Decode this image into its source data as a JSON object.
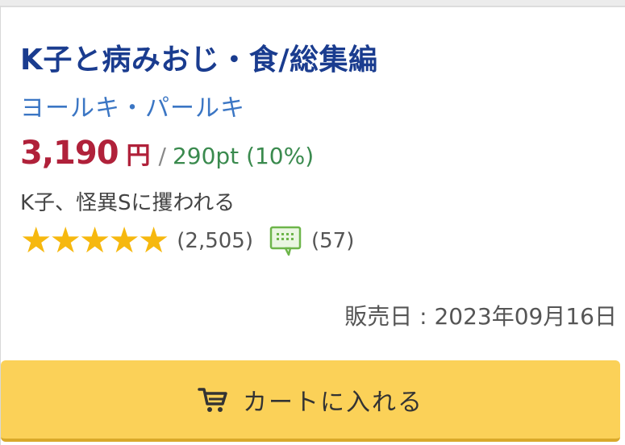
{
  "product": {
    "title": "K子と病みおじ・食/総集編",
    "author": "ヨールキ・パールキ",
    "price": "3,190",
    "currency": "円",
    "separator": "/",
    "points": "290pt (10%)",
    "subtitle": "K子、怪異Sに攫われる",
    "rating_stars": 5,
    "rating_count": "(2,505)",
    "review_count": "(57)",
    "release_date": "販売日 : 2023年09月16日"
  },
  "cart_button": {
    "label": "カートに入れる"
  },
  "colors": {
    "title": "#1a3c8f",
    "author": "#3b76c4",
    "price": "#b0213a",
    "points": "#3a8a4e",
    "star": "#f6b80f",
    "review_icon": "#6db54a",
    "button": "#fbd158"
  }
}
